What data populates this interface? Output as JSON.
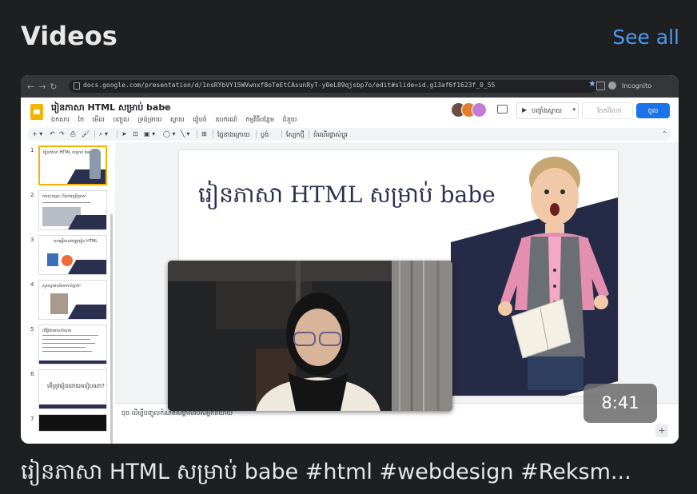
{
  "section": {
    "title": "Videos",
    "see_all": "See all"
  },
  "browser": {
    "url": "docs.google.com/presentation/d/1nsRYbVY15WVwnxf8oTeEtCAsunRyT-y0eL89qjsbp7o/edit#slide=id.g13af6f1623f_0_55",
    "incognito_label": "Incognito"
  },
  "slides_app": {
    "doc_title": "រៀនភាសា HTML សម្រាប់ babe",
    "menu": [
      "ឯកសារ",
      "កែ",
      "មើល",
      "បញ្ចូល",
      "ទ្រង់ទ្រាយ",
      "ស្លាយ",
      "រៀបចំ",
      "ឧបករណ៍",
      "កម្មវិធីបន្ថែម",
      "ជំនួយ"
    ],
    "present_label": "បញ្ចាំងស្លាយ",
    "share_ghost_label": "ចែករំលែក",
    "share_label": "ចូល",
    "toolbar": {
      "background": "ផ្ទៃខាងក្រោយ",
      "layout": "ប្លង់",
      "theme": "ស្បែកថ្មី",
      "transition": "ដំណើរផ្លាស់ប្ដូរ"
    },
    "thumbnails": [
      {
        "num": "1",
        "text": "រៀនភាសា HTML សម្រាប់ babe"
      },
      {
        "num": "2",
        "text": "ការចុះឈ្មោះ និងការប្រើប្រាស់"
      },
      {
        "num": "3",
        "text": "ហេតុអ្វីបានជាត្រូវរៀន HTML"
      },
      {
        "num": "4",
        "text": "សូមស្វាគមន៍មកកាន់ថ្នាក់!"
      },
      {
        "num": "5",
        "text": "តើអ្វីជាគោលបំណង"
      },
      {
        "num": "6",
        "text": "តើត្រូវរៀនដោយរបៀបណា?"
      },
      {
        "num": "7",
        "text": ""
      }
    ],
    "slide_title": "រៀនភាសា HTML សម្រាប់ babe",
    "speaker_notes": "ចុច ដើម្បីបញ្ចូលកំណត់សម្គាល់របស់អ្នកនិយាយ"
  },
  "video": {
    "duration": "8:41",
    "title": "រៀនភាសា HTML សម្រាប់ babe #html #webdesign #Reksm..."
  },
  "colors": {
    "page_bg": "#1e1f21",
    "link_blue": "#4b9cf5",
    "slide_navy": "#252a47",
    "slides_yellow": "#f6b400",
    "share_blue": "#1a73e8"
  }
}
